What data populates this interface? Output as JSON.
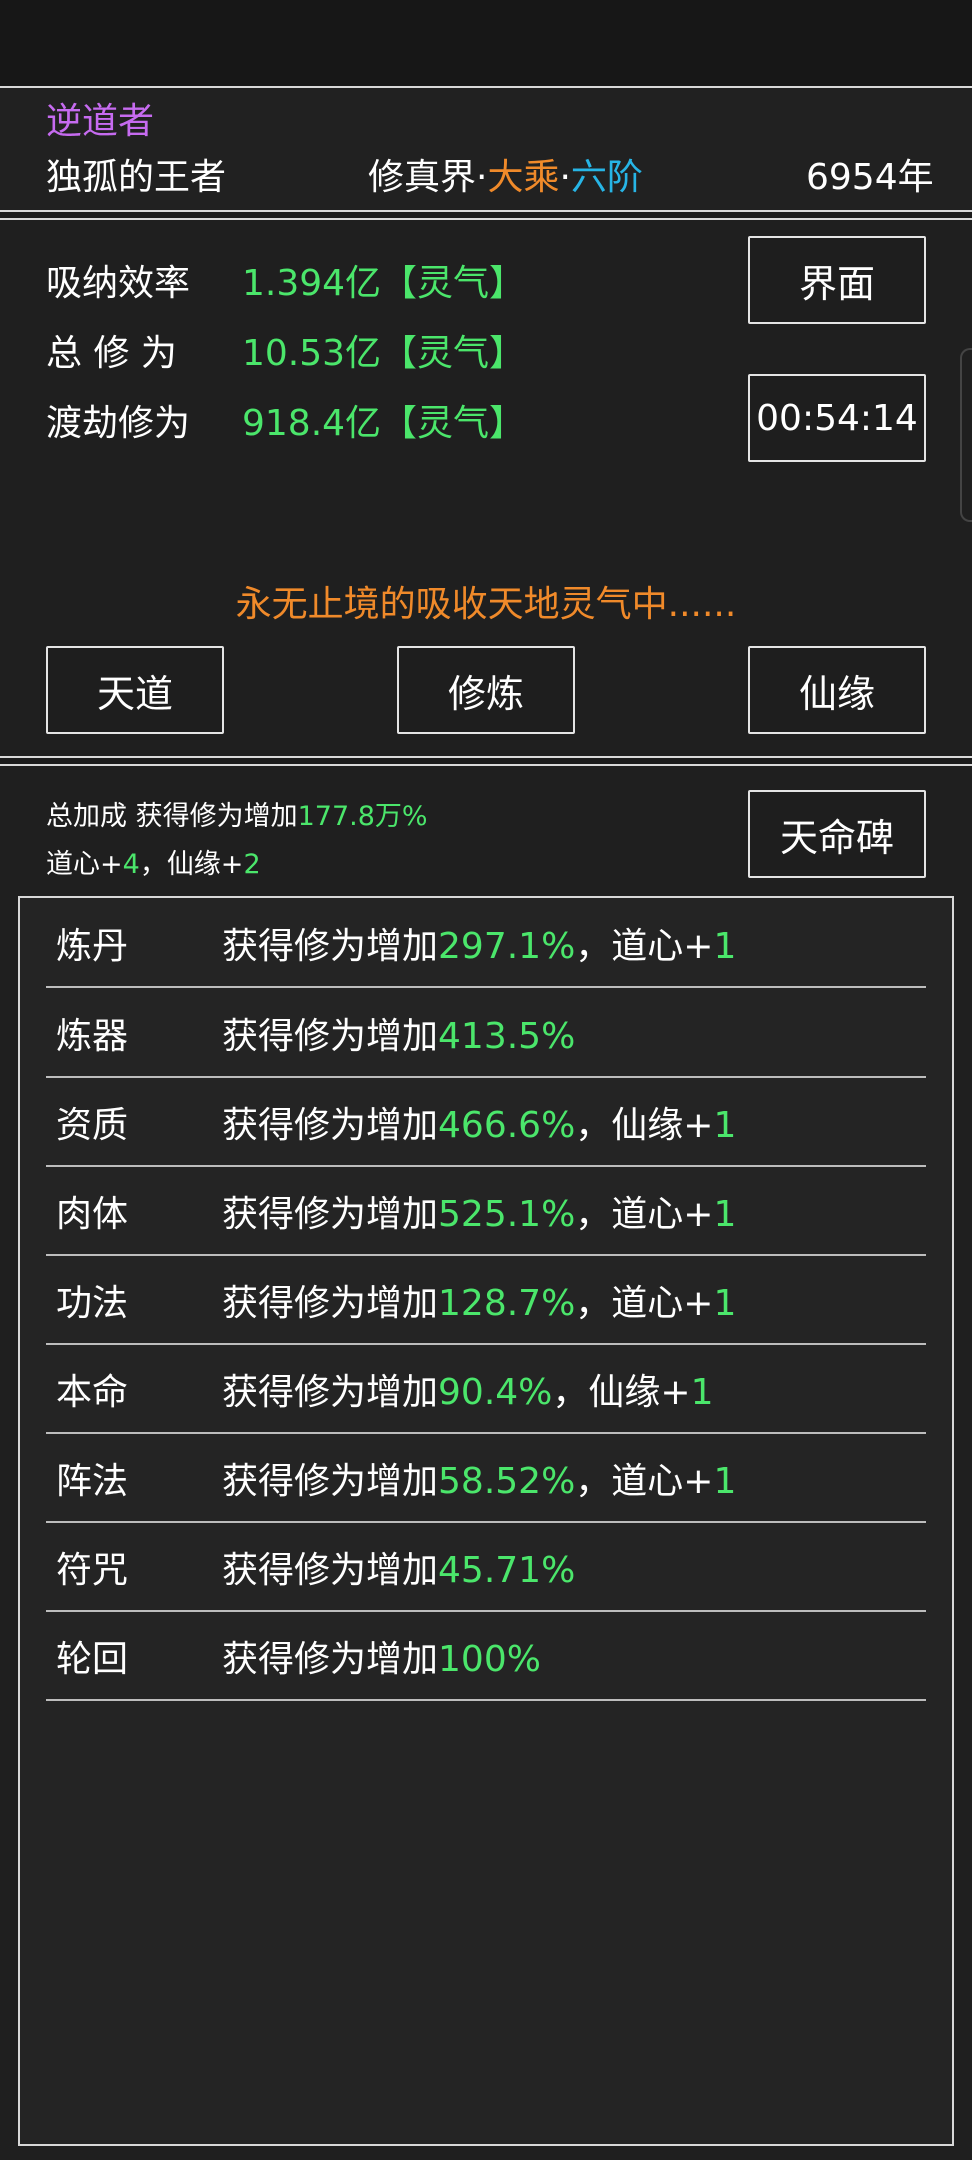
{
  "header": {
    "title": "逆道者",
    "player_name": "独孤的王者",
    "realm_prefix": "修真界·",
    "realm_rank": "大乘",
    "realm_sep": "·",
    "realm_stage": "六阶",
    "years": "6954年"
  },
  "stats": [
    {
      "label": "吸纳效率",
      "value": "1.394亿【灵气】"
    },
    {
      "label": "总 修 为",
      "value": "10.53亿【灵气】"
    },
    {
      "label": "渡劫修为",
      "value": "918.4亿【灵气】"
    }
  ],
  "buttons": {
    "interface": "界面",
    "timer": "00:54:14",
    "tiandao": "天道",
    "xiulian": "修炼",
    "xianyuan": "仙缘",
    "tianmingbei": "天命碑"
  },
  "status_text": "永无止境的吸收天地灵气中......",
  "bonus": {
    "line1_prefix": "总加成 获得修为增加",
    "line1_value": "177.8万%",
    "daoxin_label": "道心+",
    "daoxin_value": "4",
    "comma": "，",
    "xianyuan_label": "仙缘+",
    "xianyuan_value": "2"
  },
  "list": [
    {
      "name": "炼丹",
      "prefix": "获得修为增加",
      "value": "297.1%",
      "extra_label": "，道心+",
      "extra_value": "1"
    },
    {
      "name": "炼器",
      "prefix": "获得修为增加",
      "value": "413.5%",
      "extra_label": "",
      "extra_value": ""
    },
    {
      "name": "资质",
      "prefix": "获得修为增加",
      "value": "466.6%",
      "extra_label": "，仙缘+",
      "extra_value": "1"
    },
    {
      "name": "肉体",
      "prefix": "获得修为增加",
      "value": "525.1%",
      "extra_label": "，道心+",
      "extra_value": "1"
    },
    {
      "name": "功法",
      "prefix": "获得修为增加",
      "value": "128.7%",
      "extra_label": "，道心+",
      "extra_value": "1"
    },
    {
      "name": "本命",
      "prefix": "获得修为增加",
      "value": "90.4%",
      "extra_label": "，仙缘+",
      "extra_value": "1"
    },
    {
      "name": "阵法",
      "prefix": "获得修为增加",
      "value": "58.52%",
      "extra_label": "，道心+",
      "extra_value": "1"
    },
    {
      "name": "符咒",
      "prefix": "获得修为增加",
      "value": "45.71%",
      "extra_label": "",
      "extra_value": ""
    },
    {
      "name": "轮回",
      "prefix": "获得修为增加",
      "value": "100%",
      "extra_label": "",
      "extra_value": ""
    }
  ],
  "colors": {
    "title": "#c66bf0",
    "realm_rank": "#f08a2a",
    "realm_stage": "#27b5e6",
    "value_green": "#4be66b",
    "status": "#f08a2a"
  }
}
